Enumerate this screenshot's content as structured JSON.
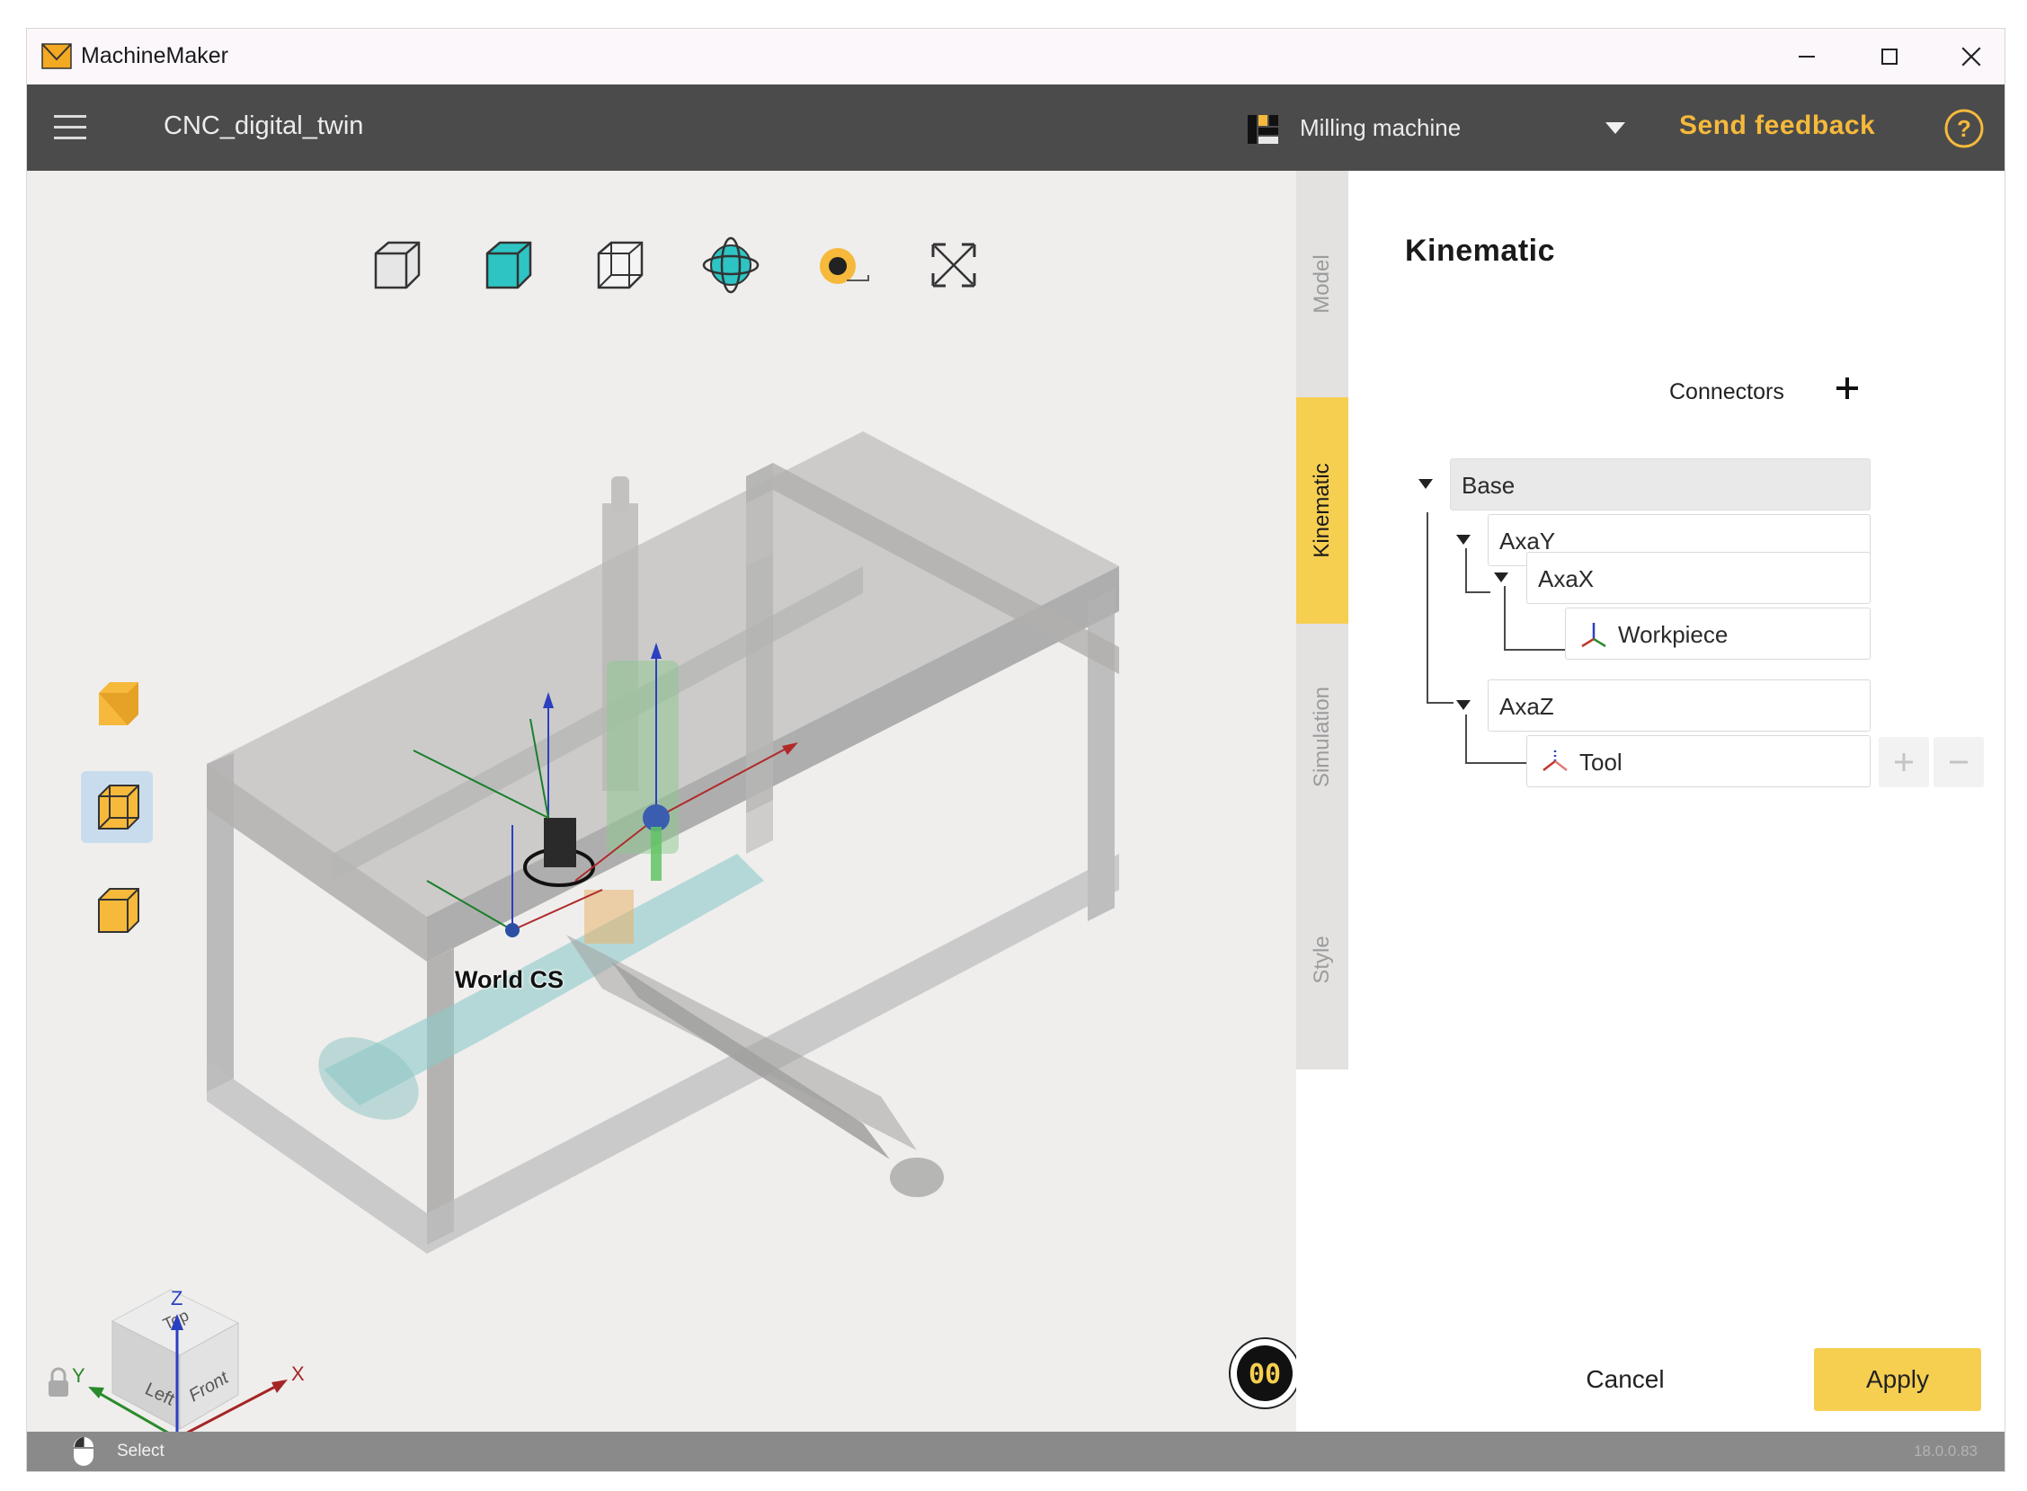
{
  "window": {
    "title": "MachineMaker",
    "controls": {
      "minimize_icon": "minimize-icon",
      "maximize_icon": "maximize-icon",
      "close_icon": "close-icon"
    }
  },
  "header": {
    "project_name": "CNC_digital_twin",
    "machine_type": "Milling machine",
    "feedback_label": "Send feedback",
    "accent_color": "#f6b93b"
  },
  "viewport": {
    "toolbar": [
      {
        "name": "wireframe-view-icon"
      },
      {
        "name": "shaded-view-icon"
      },
      {
        "name": "outline-view-icon"
      },
      {
        "name": "orbit-icon"
      },
      {
        "name": "measure-tape-icon"
      },
      {
        "name": "fit-view-icon"
      }
    ],
    "world_cs_label": "World CS",
    "nav_cube": {
      "top": "Top",
      "left": "Left",
      "front": "Front",
      "axis_x": "X",
      "axis_y": "Y",
      "axis_z": "Z"
    },
    "fps_counter": "00"
  },
  "tabs": [
    {
      "label": "Model",
      "active": false
    },
    {
      "label": "Kinematic",
      "active": true
    },
    {
      "label": "Simulation",
      "active": false
    },
    {
      "label": "Style",
      "active": false
    }
  ],
  "panel": {
    "title": "Kinematic",
    "connectors_label": "Connectors",
    "tree": {
      "base": "Base",
      "axa_y": "AxaY",
      "axa_x": "AxaX",
      "workpiece": "Workpiece",
      "axa_z": "AxaZ",
      "tool": "Tool"
    },
    "cancel_label": "Cancel",
    "apply_label": "Apply"
  },
  "statusbar": {
    "mode": "Select",
    "version": "18.0.0.83"
  }
}
